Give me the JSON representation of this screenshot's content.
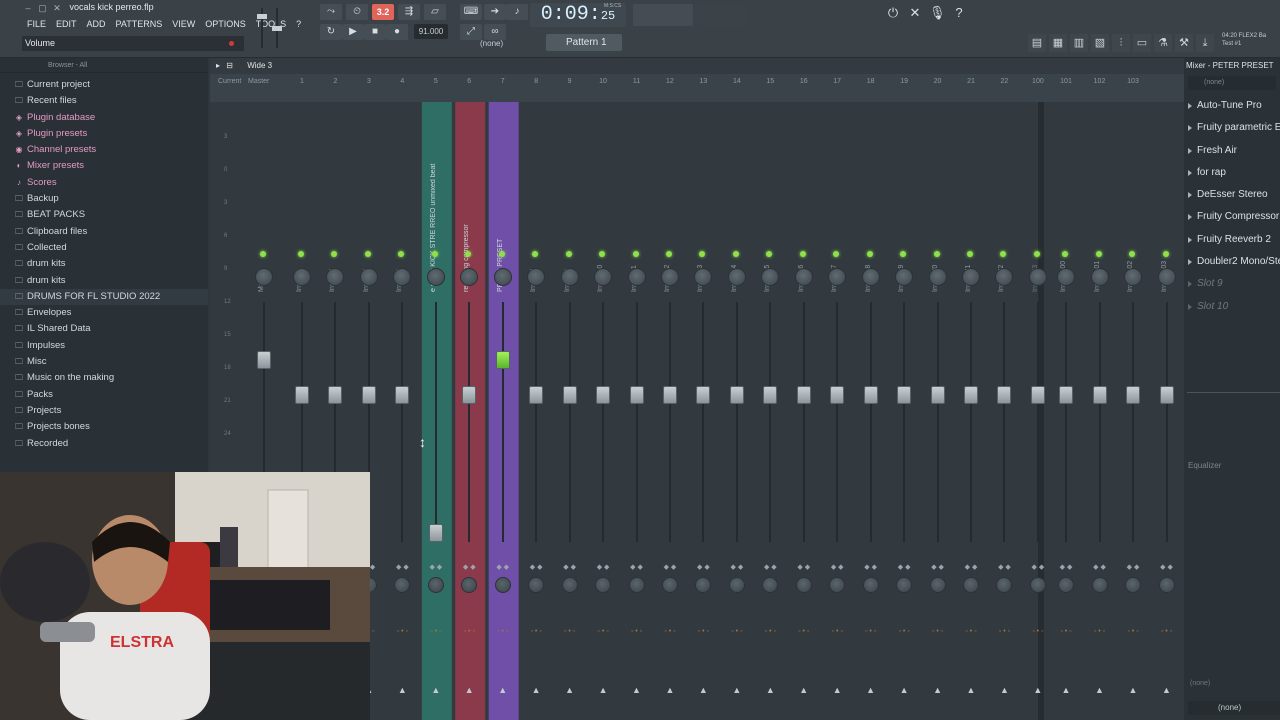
{
  "window": {
    "title": "vocals kick perreo.flp"
  },
  "menu": [
    "FILE",
    "EDIT",
    "ADD",
    "PATTERNS",
    "VIEW",
    "OPTIONS",
    "TOOLS",
    "?"
  ],
  "hint_bar": {
    "text": "Volume"
  },
  "transport": {
    "pattern_song_label": "3.2",
    "tempo": "91.000",
    "time_main": "0:09",
    "time_sub": "25",
    "msecs_label": "M:S:CS",
    "none_label": "(none)",
    "pattern_name": "Pattern 1"
  },
  "corner_info": {
    "line1": "04:20 FLEX2 Ba",
    "line2": "Test #1"
  },
  "browser": {
    "header": "Browser - All",
    "items": [
      {
        "label": "Current project",
        "icon": "folder-icon",
        "pink": false
      },
      {
        "label": "Recent files",
        "icon": "folder-icon",
        "pink": false
      },
      {
        "label": "Plugin database",
        "icon": "plug-icon",
        "pink": true
      },
      {
        "label": "Plugin presets",
        "icon": "plug-icon",
        "pink": true
      },
      {
        "label": "Channel presets",
        "icon": "channel-icon",
        "pink": true
      },
      {
        "label": "Mixer presets",
        "icon": "mixer-icon",
        "pink": true
      },
      {
        "label": "Scores",
        "icon": "note-icon",
        "pink": true
      },
      {
        "label": "Backup",
        "icon": "folder-icon",
        "pink": false
      },
      {
        "label": "BEAT PACKS",
        "icon": "folder-icon",
        "pink": false
      },
      {
        "label": "Clipboard files",
        "icon": "folder-icon",
        "pink": false
      },
      {
        "label": "Collected",
        "icon": "folder-icon",
        "pink": false
      },
      {
        "label": "drum kits",
        "icon": "folder-icon",
        "pink": false
      },
      {
        "label": "drum kits",
        "icon": "folder-icon",
        "pink": false
      },
      {
        "label": "DRUMS FOR FL STUDIO 2022",
        "icon": "folder-icon",
        "pink": false
      },
      {
        "label": "Envelopes",
        "icon": "folder-icon",
        "pink": false
      },
      {
        "label": "IL Shared Data",
        "icon": "folder-icon",
        "pink": false
      },
      {
        "label": "Impulses",
        "icon": "folder-icon",
        "pink": false
      },
      {
        "label": "Misc",
        "icon": "folder-icon",
        "pink": false
      },
      {
        "label": "Music on the making",
        "icon": "folder-icon",
        "pink": false
      },
      {
        "label": "Packs",
        "icon": "folder-icon",
        "pink": false
      },
      {
        "label": "Projects",
        "icon": "folder-icon",
        "pink": false
      },
      {
        "label": "Projects bones",
        "icon": "folder-icon",
        "pink": false
      },
      {
        "label": "Recorded",
        "icon": "folder-icon",
        "pink": false
      }
    ]
  },
  "mixer": {
    "toolbar_label": "Wide 3",
    "header_title": "Mixer - PETER PRESET",
    "header_col1": "Current",
    "header_col2": "Master",
    "channel_numbers": [
      "1",
      "2",
      "3",
      "4",
      "5",
      "6",
      "7",
      "8",
      "9",
      "10",
      "11",
      "12",
      "13",
      "14",
      "15",
      "16",
      "17",
      "18",
      "19",
      "20",
      "21",
      "22",
      "100",
      "101",
      "102",
      "103"
    ],
    "strips": [
      {
        "name": "Master",
        "fader_level": 0.78,
        "green": false,
        "mute": false
      },
      {
        "name": "Insert 1",
        "fader_level": 0.62,
        "green": false,
        "mute": false
      },
      {
        "name": "Insert 2",
        "fader_level": 0.62,
        "green": false,
        "mute": false
      },
      {
        "name": "Insert 3",
        "fader_level": 0.62,
        "green": false,
        "mute": false
      },
      {
        "name": "Insert 4",
        "fader_level": 0.62,
        "green": false,
        "mute": false
      },
      {
        "name": "e minor KICK STRE RREO unmixed beat",
        "fader_level": 0.0,
        "green": false,
        "mute": false
      },
      {
        "name": "recording compressor",
        "fader_level": 0.62,
        "green": false,
        "mute": false
      },
      {
        "name": "PETER PRESET",
        "fader_level": 0.78,
        "green": true,
        "mute": false
      },
      {
        "name": "Insert 8",
        "fader_level": 0.62,
        "green": false,
        "mute": false
      },
      {
        "name": "Insert 9",
        "fader_level": 0.62,
        "green": false,
        "mute": false
      },
      {
        "name": "Insert 10",
        "fader_level": 0.62,
        "green": false,
        "mute": false
      },
      {
        "name": "Insert 11",
        "fader_level": 0.62,
        "green": false,
        "mute": false
      },
      {
        "name": "Insert 12",
        "fader_level": 0.62,
        "green": false,
        "mute": false
      },
      {
        "name": "Insert 13",
        "fader_level": 0.62,
        "green": false,
        "mute": false
      },
      {
        "name": "Insert 14",
        "fader_level": 0.62,
        "green": false,
        "mute": false
      },
      {
        "name": "Insert 15",
        "fader_level": 0.62,
        "green": false,
        "mute": false
      },
      {
        "name": "Insert 16",
        "fader_level": 0.62,
        "green": false,
        "mute": false
      },
      {
        "name": "Insert 17",
        "fader_level": 0.62,
        "green": false,
        "mute": false
      },
      {
        "name": "Insert 18",
        "fader_level": 0.62,
        "green": false,
        "mute": false
      },
      {
        "name": "Insert 19",
        "fader_level": 0.62,
        "green": false,
        "mute": false
      },
      {
        "name": "Insert 20",
        "fader_level": 0.62,
        "green": false,
        "mute": false
      },
      {
        "name": "Insert 21",
        "fader_level": 0.62,
        "green": false,
        "mute": false
      },
      {
        "name": "Insert 22",
        "fader_level": 0.62,
        "green": false,
        "mute": false
      },
      {
        "name": "Insert 23",
        "fader_level": 0.62,
        "green": false,
        "mute": true
      },
      {
        "name": "Insert 100",
        "fader_level": 0.62,
        "green": false,
        "mute": false
      },
      {
        "name": "Insert 101",
        "fader_level": 0.62,
        "green": false,
        "mute": false
      },
      {
        "name": "Insert 102",
        "fader_level": 0.62,
        "green": false,
        "mute": false
      },
      {
        "name": "Insert 103",
        "fader_level": 0.62,
        "green": false,
        "mute": false
      }
    ],
    "scale_marks": [
      "3",
      "0",
      "3",
      "6",
      "9",
      "12",
      "15",
      "18",
      "21",
      "24"
    ]
  },
  "fx_panel": {
    "input_none": "(none)",
    "slots": [
      {
        "label": "Auto-Tune Pro",
        "empty": false
      },
      {
        "label": "Fruity parametric EQ 2",
        "empty": false
      },
      {
        "label": "Fresh Air",
        "empty": false
      },
      {
        "label": "for rap",
        "empty": false
      },
      {
        "label": "DeEsser Stereo",
        "empty": false
      },
      {
        "label": "Fruity Compressor",
        "empty": false
      },
      {
        "label": "Fruity Reeverb 2",
        "empty": false
      },
      {
        "label": "Doubler2 Mono/Stereo",
        "empty": false
      },
      {
        "label": "Slot 9",
        "empty": true
      },
      {
        "label": "Slot 10",
        "empty": true
      }
    ],
    "eq_label": "Equalizer",
    "output_none_1": "(none)",
    "output_none_2": "(none)"
  },
  "colors": {
    "accent_green": "#8fe04a",
    "selected_purple": "#6f4fa8",
    "selected_red": "#8a3a4a",
    "teal": "#2f6e64",
    "pink_items": "#e39bc5"
  }
}
